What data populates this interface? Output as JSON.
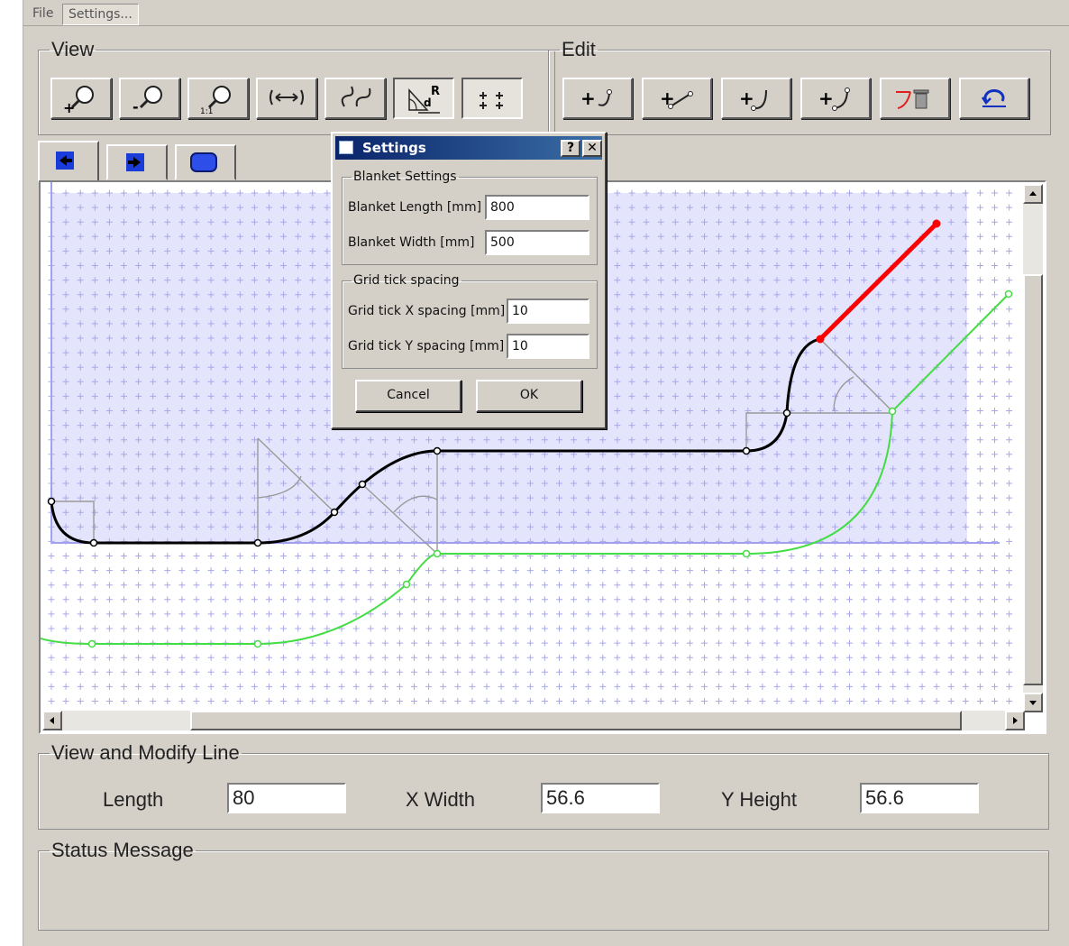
{
  "menu": {
    "file": "File",
    "settings": "Settings..."
  },
  "view_group": {
    "legend": "View"
  },
  "edit_group": {
    "legend": "Edit"
  },
  "view_line": {
    "legend": "View and Modify Line",
    "length_label": "Length",
    "length_value": "80",
    "xwidth_label": "X Width",
    "xwidth_value": "56.6",
    "yheight_label": "Y Height",
    "yheight_value": "56.6"
  },
  "status": {
    "legend": "Status Message",
    "text": ""
  },
  "dialog": {
    "title": "Settings",
    "help_glyph": "?",
    "close_glyph": "✕",
    "blanket_legend": "Blanket Settings",
    "blanket_length_label": "Blanket Length [mm]",
    "blanket_length_value": "800",
    "blanket_width_label": "Blanket Width [mm]",
    "blanket_width_value": "500",
    "grid_legend": "Grid tick spacing",
    "grid_x_label": "Grid tick X spacing [mm]",
    "grid_x_value": "10",
    "grid_y_label": "Grid tick Y spacing [mm]",
    "grid_y_value": "10",
    "cancel": "Cancel",
    "ok": "OK"
  },
  "toolbar_icons": {
    "view": [
      "zoom-in-icon",
      "zoom-out-icon",
      "zoom-1-1-icon",
      "fit-width-icon",
      "fit-curve-icon",
      "dimension-angle-icon",
      "grid-toggle-icon"
    ],
    "edit": [
      "add-curve-end-icon",
      "add-line-segment-icon",
      "add-curve-start-icon",
      "add-curve-icon",
      "delete-segment-icon",
      "undo-icon"
    ]
  },
  "colors": {
    "selected_segment": "#ff0000",
    "offset_line": "#44dd44",
    "main_line": "#000000",
    "blanket_fill": "#e4e4fc",
    "grid_cross": "#a8a8e8"
  }
}
